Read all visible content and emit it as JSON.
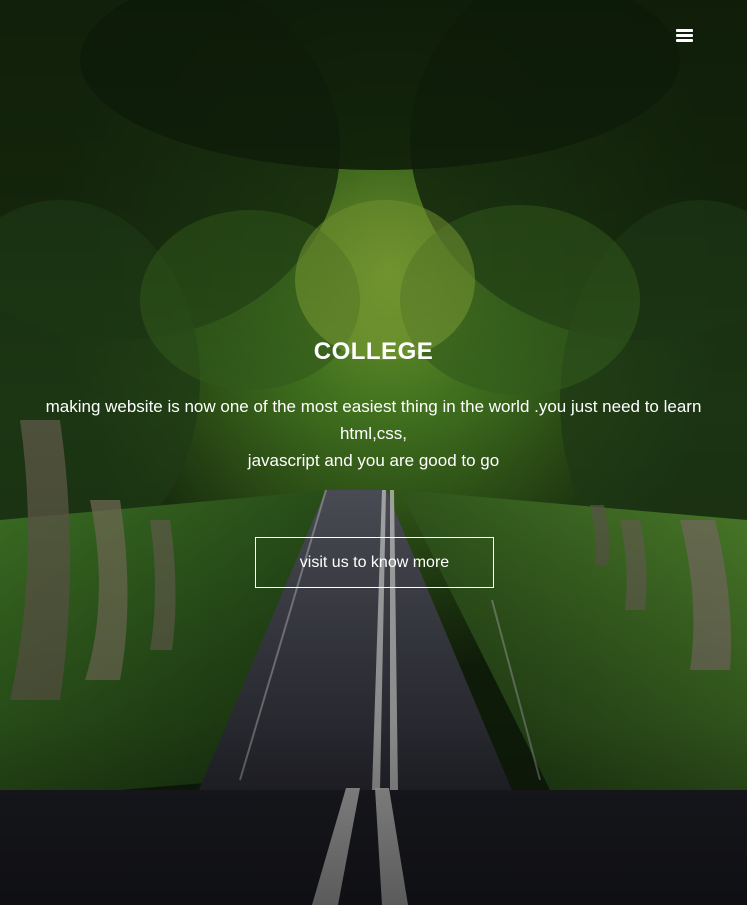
{
  "nav": {
    "menu_icon": "hamburger-menu-icon"
  },
  "hero": {
    "title": "COLLEGE",
    "description_line1": "making website is now one of the most easiest thing in the world .you just need to learn html,css,",
    "description_line2": "javascript and you are good to go",
    "cta_label": "visit us to know more"
  },
  "colors": {
    "text": "#ffffff",
    "foliage": "#2f5a1e",
    "road": "#2a2a36"
  }
}
